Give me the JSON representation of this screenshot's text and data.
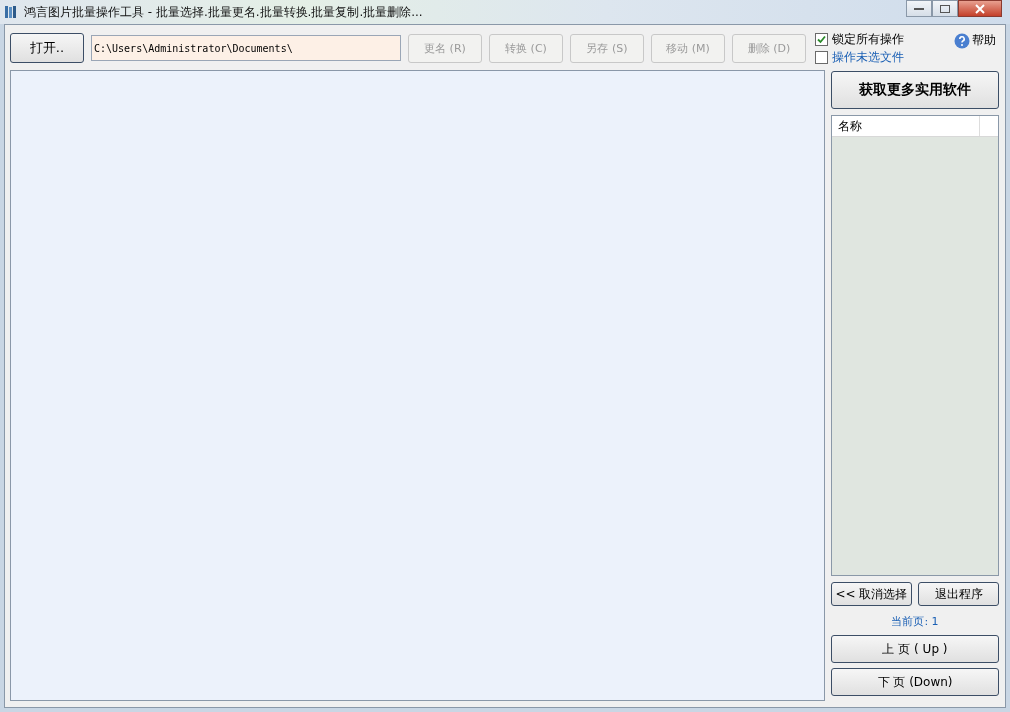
{
  "window": {
    "title": "鸿言图片批量操作工具 - 批量选择.批量更名.批量转换.批量复制.批量删除..."
  },
  "toolbar": {
    "open_button": "打开..",
    "path": {
      "value": "C:\\Users\\Administrator\\Documents\\"
    },
    "actions": [
      {
        "label": "更名 (R)",
        "disabled": true
      },
      {
        "label": "转换 (C)",
        "disabled": true
      },
      {
        "label": "另存 (S)",
        "disabled": true
      },
      {
        "label": "移动 (M)",
        "disabled": true
      },
      {
        "label": "删除 (D)",
        "disabled": true
      }
    ],
    "options": [
      {
        "label": "锁定所有操作",
        "checked": true,
        "kind": "plain"
      },
      {
        "label": "操作未选文件",
        "checked": false,
        "kind": "link"
      }
    ],
    "help": "帮助"
  },
  "side_panel": {
    "get_more_button": "获取更多实用软件",
    "list": {
      "columns": [
        "名称"
      ]
    },
    "cancel_button": "<< 取消选择",
    "exit_button": "退出程序",
    "current_page": "当前页: 1",
    "prev_button": "上 页 ( Up )",
    "next_button": "下 页 (Down)"
  }
}
